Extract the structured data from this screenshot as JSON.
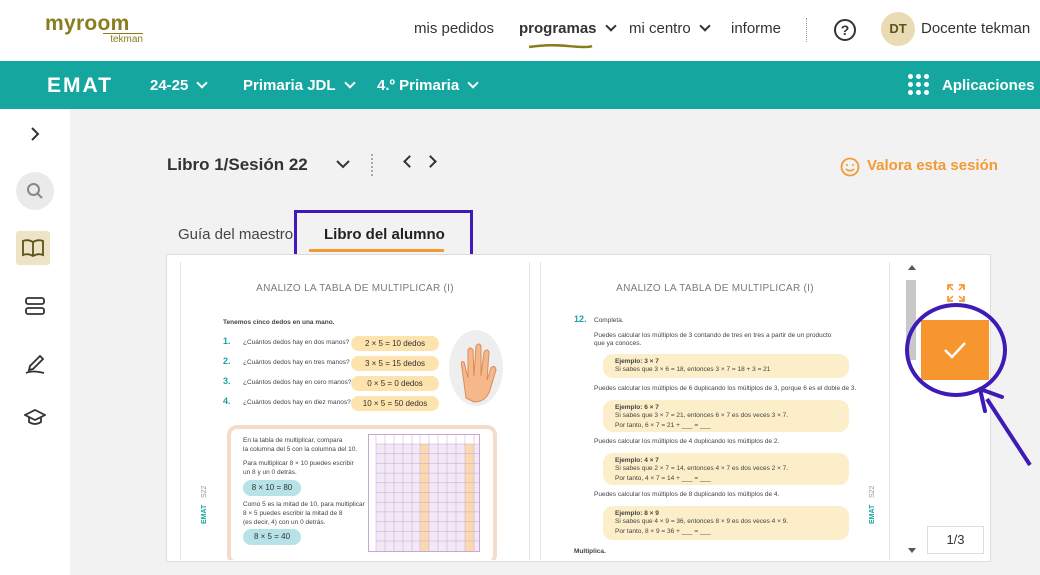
{
  "brand": {
    "name": "myroom",
    "sub": "tekman"
  },
  "topnav": {
    "mis_pedidos": "mis pedidos",
    "programas": "programas",
    "mi_centro": "mi centro",
    "informe": "informe",
    "help": "?",
    "avatar_initials": "DT",
    "user_name": "Docente tekman"
  },
  "program_bar": {
    "logo": "EMAT",
    "year": "24-25",
    "school": "Primaria JDL",
    "grade": "4.º Primaria",
    "apps": "Aplicaciones"
  },
  "session": {
    "title": "Libro 1/Sesión 22",
    "rate": "Valora esta sesión"
  },
  "tabs": [
    {
      "label": "Guía del maestro",
      "active": false
    },
    {
      "label": "Libro del alumno",
      "active": true
    }
  ],
  "left_page": {
    "title": "ANALIZO LA TABLA DE MULTIPLICAR (I)",
    "intro": "Tenemos cinco dedos en una mano.",
    "questions": [
      {
        "num": "1.",
        "text": "¿Cuántos dedos hay en dos manos?",
        "answer": "2 × 5 = 10 dedos"
      },
      {
        "num": "2.",
        "text": "¿Cuántos dedos hay en tres manos?",
        "answer": "3 × 5 = 15 dedos"
      },
      {
        "num": "3.",
        "text": "¿Cuántos dedos hay en cero manos?",
        "answer": "0 × 5 = 0 dedos"
      },
      {
        "num": "4.",
        "text": "¿Cuántos dedos hay en diez manos?",
        "answer": "10 × 5 = 50 dedos"
      }
    ],
    "box_lines": [
      "En la tabla de multiplicar, compara",
      "la columna del 5 con la columna del 10.",
      "Para multiplicar 8 × 10 puedes escribir",
      "un 8 y un 0 detrás.",
      "Como 5 es la mitad de 10, para multiplicar",
      "8 × 5 puedes escribir la mitad de 8",
      "(es decir, 4) con un 0 detrás."
    ],
    "pill1": "8 × 10 = 80",
    "pill2": "8 × 5 = 40",
    "side_code": "S22",
    "side_logo": "EMAT"
  },
  "right_page": {
    "title": "ANALIZO LA TABLA DE MULTIPLICAR (I)",
    "q_num": "12.",
    "q_label": "Completa.",
    "p1": "Puedes calcular los múltiplos de 3 contando de tres en tres a partir de un producto",
    "p1b": "que ya conoces.",
    "ex1_title": "Ejemplo: 3 × 7",
    "ex1_line": "Si sabes que 3 × 6 = 18, entonces 3 × 7 = 18 + 3 = 21",
    "p2": "Puedes calcular los múltiplos de 6 duplicando los múltiplos de 3, porque 6 es el doble de 3.",
    "ex2_title": "Ejemplo: 6 × 7",
    "ex2_line": "Si sabes que 3 × 7 = 21, entonces 6 × 7 es dos veces 3 × 7.",
    "ex2_line2": "Por tanto, 6 × 7 = 21 + ___ = ___",
    "p3": "Puedes calcular los múltiplos de 4 duplicando los múltiplos de 2.",
    "ex3_title": "Ejemplo: 4 × 7",
    "ex3_line": "Si sabes que 2 × 7 = 14, entonces 4 × 7 es dos veces 2 × 7.",
    "ex3_line2": "Por tanto, 4 × 7 = 14 + ___ = ___",
    "p4": "Puedes calcular los múltiplos de 8 duplicando los múltiplos de 4.",
    "ex4_title": "Ejemplo: 8 × 9",
    "ex4_line": "Si sabes que 4 × 9 = 36, entonces 8 × 9 es dos veces 4 × 9.",
    "ex4_line2": "Por tanto, 8 × 9 = 36 + ___ = ___",
    "footer": "Multiplica.",
    "side_code": "S22",
    "side_logo": "EMAT"
  },
  "viewer": {
    "page_counter": "1/3"
  },
  "colors": {
    "teal": "#15a79f",
    "orange": "#f7962f",
    "annotation": "#3f1bb5",
    "olive": "#8a7d1e"
  }
}
